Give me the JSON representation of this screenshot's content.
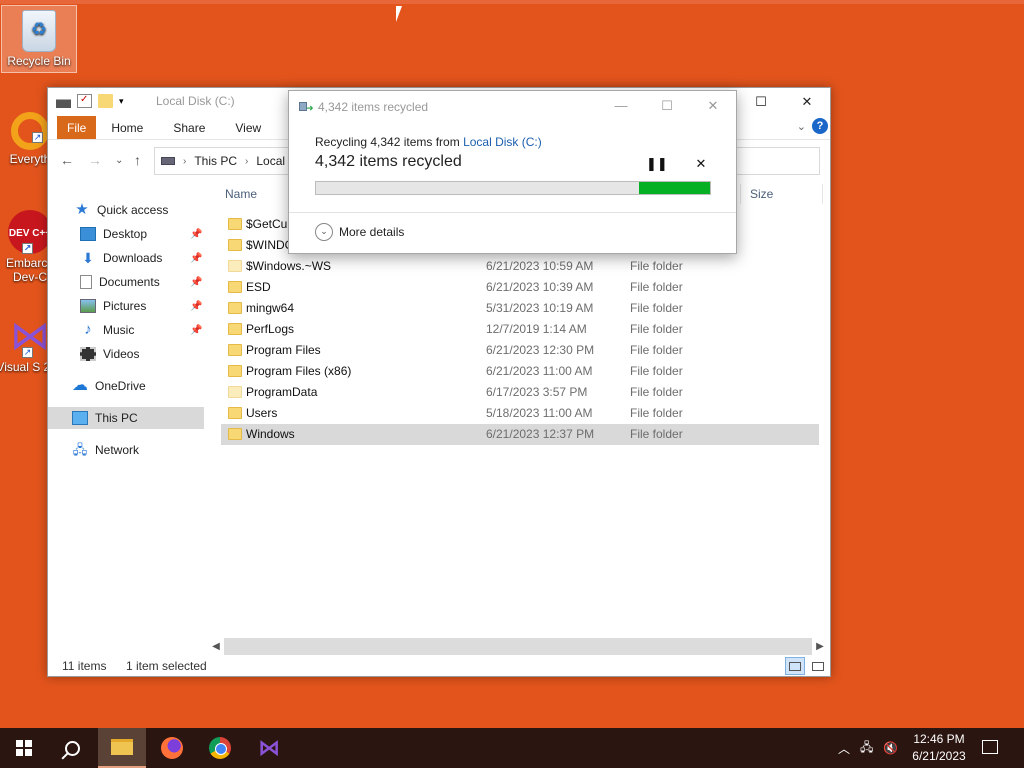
{
  "desktop": {
    "icons": [
      {
        "label": "Recycle Bin"
      },
      {
        "label": "Everyth"
      },
      {
        "label": "Embarca Dev-C"
      },
      {
        "label": "Visual S 201"
      }
    ],
    "devc_badge": "DEV C++"
  },
  "explorer": {
    "title": "Local Disk (C:)",
    "tabs": [
      "File",
      "Home",
      "Share",
      "View"
    ],
    "help": "?",
    "breadcrumb": [
      "This PC",
      "Local D"
    ],
    "nav": {
      "quick_access": "Quick access",
      "items": [
        "Desktop",
        "Downloads",
        "Documents",
        "Pictures",
        "Music",
        "Videos"
      ],
      "onedrive": "OneDrive",
      "this_pc": "This PC",
      "network": "Network"
    },
    "columns": {
      "name": "Name",
      "size": "Size"
    },
    "rows": [
      {
        "name": "$GetCur",
        "date": "",
        "type": "",
        "faded": false
      },
      {
        "name": "$WINDO",
        "date": "",
        "type": "",
        "faded": false
      },
      {
        "name": "$Windows.~WS",
        "date": "6/21/2023 10:59 AM",
        "type": "File folder",
        "faded": true
      },
      {
        "name": "ESD",
        "date": "6/21/2023 10:39 AM",
        "type": "File folder",
        "faded": false
      },
      {
        "name": "mingw64",
        "date": "5/31/2023 10:19 AM",
        "type": "File folder",
        "faded": false
      },
      {
        "name": "PerfLogs",
        "date": "12/7/2019 1:14 AM",
        "type": "File folder",
        "faded": false
      },
      {
        "name": "Program Files",
        "date": "6/21/2023 12:30 PM",
        "type": "File folder",
        "faded": false
      },
      {
        "name": "Program Files (x86)",
        "date": "6/21/2023 11:00 AM",
        "type": "File folder",
        "faded": false
      },
      {
        "name": "ProgramData",
        "date": "6/17/2023 3:57 PM",
        "type": "File folder",
        "faded": true
      },
      {
        "name": "Users",
        "date": "5/18/2023 11:00 AM",
        "type": "File folder",
        "faded": false
      },
      {
        "name": "Windows",
        "date": "6/21/2023 12:37 PM",
        "type": "File folder",
        "faded": false
      }
    ],
    "status": {
      "count": "11 items",
      "selected": "1 item selected"
    }
  },
  "dialog": {
    "title": "4,342 items recycled",
    "sub_prefix": "Recycling 4,342 items from ",
    "sub_link": "Local Disk (C:)",
    "main": "4,342 items recycled",
    "progress": 0.18,
    "more_details": "More details"
  },
  "taskbar": {
    "time": "12:46 PM",
    "date": "6/21/2023"
  },
  "colors": {
    "desktop": "#e3541c",
    "file_tab": "#d8681a",
    "progress_fill": "#06b025",
    "accent_link": "#1c5fae"
  }
}
